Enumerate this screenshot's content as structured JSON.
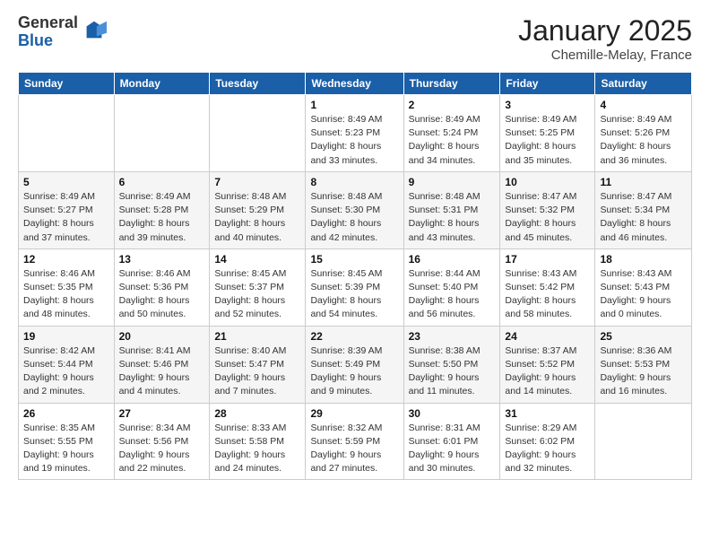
{
  "logo": {
    "general": "General",
    "blue": "Blue"
  },
  "title": "January 2025",
  "subtitle": "Chemille-Melay, France",
  "days_of_week": [
    "Sunday",
    "Monday",
    "Tuesday",
    "Wednesday",
    "Thursday",
    "Friday",
    "Saturday"
  ],
  "weeks": [
    [
      {
        "day": "",
        "info": ""
      },
      {
        "day": "",
        "info": ""
      },
      {
        "day": "",
        "info": ""
      },
      {
        "day": "1",
        "sunrise": "8:49 AM",
        "sunset": "5:23 PM",
        "daylight": "8 hours and 33 minutes."
      },
      {
        "day": "2",
        "sunrise": "8:49 AM",
        "sunset": "5:24 PM",
        "daylight": "8 hours and 34 minutes."
      },
      {
        "day": "3",
        "sunrise": "8:49 AM",
        "sunset": "5:25 PM",
        "daylight": "8 hours and 35 minutes."
      },
      {
        "day": "4",
        "sunrise": "8:49 AM",
        "sunset": "5:26 PM",
        "daylight": "8 hours and 36 minutes."
      }
    ],
    [
      {
        "day": "5",
        "sunrise": "8:49 AM",
        "sunset": "5:27 PM",
        "daylight": "8 hours and 37 minutes."
      },
      {
        "day": "6",
        "sunrise": "8:49 AM",
        "sunset": "5:28 PM",
        "daylight": "8 hours and 39 minutes."
      },
      {
        "day": "7",
        "sunrise": "8:48 AM",
        "sunset": "5:29 PM",
        "daylight": "8 hours and 40 minutes."
      },
      {
        "day": "8",
        "sunrise": "8:48 AM",
        "sunset": "5:30 PM",
        "daylight": "8 hours and 42 minutes."
      },
      {
        "day": "9",
        "sunrise": "8:48 AM",
        "sunset": "5:31 PM",
        "daylight": "8 hours and 43 minutes."
      },
      {
        "day": "10",
        "sunrise": "8:47 AM",
        "sunset": "5:32 PM",
        "daylight": "8 hours and 45 minutes."
      },
      {
        "day": "11",
        "sunrise": "8:47 AM",
        "sunset": "5:34 PM",
        "daylight": "8 hours and 46 minutes."
      }
    ],
    [
      {
        "day": "12",
        "sunrise": "8:46 AM",
        "sunset": "5:35 PM",
        "daylight": "8 hours and 48 minutes."
      },
      {
        "day": "13",
        "sunrise": "8:46 AM",
        "sunset": "5:36 PM",
        "daylight": "8 hours and 50 minutes."
      },
      {
        "day": "14",
        "sunrise": "8:45 AM",
        "sunset": "5:37 PM",
        "daylight": "8 hours and 52 minutes."
      },
      {
        "day": "15",
        "sunrise": "8:45 AM",
        "sunset": "5:39 PM",
        "daylight": "8 hours and 54 minutes."
      },
      {
        "day": "16",
        "sunrise": "8:44 AM",
        "sunset": "5:40 PM",
        "daylight": "8 hours and 56 minutes."
      },
      {
        "day": "17",
        "sunrise": "8:43 AM",
        "sunset": "5:42 PM",
        "daylight": "8 hours and 58 minutes."
      },
      {
        "day": "18",
        "sunrise": "8:43 AM",
        "sunset": "5:43 PM",
        "daylight": "9 hours and 0 minutes."
      }
    ],
    [
      {
        "day": "19",
        "sunrise": "8:42 AM",
        "sunset": "5:44 PM",
        "daylight": "9 hours and 2 minutes."
      },
      {
        "day": "20",
        "sunrise": "8:41 AM",
        "sunset": "5:46 PM",
        "daylight": "9 hours and 4 minutes."
      },
      {
        "day": "21",
        "sunrise": "8:40 AM",
        "sunset": "5:47 PM",
        "daylight": "9 hours and 7 minutes."
      },
      {
        "day": "22",
        "sunrise": "8:39 AM",
        "sunset": "5:49 PM",
        "daylight": "9 hours and 9 minutes."
      },
      {
        "day": "23",
        "sunrise": "8:38 AM",
        "sunset": "5:50 PM",
        "daylight": "9 hours and 11 minutes."
      },
      {
        "day": "24",
        "sunrise": "8:37 AM",
        "sunset": "5:52 PM",
        "daylight": "9 hours and 14 minutes."
      },
      {
        "day": "25",
        "sunrise": "8:36 AM",
        "sunset": "5:53 PM",
        "daylight": "9 hours and 16 minutes."
      }
    ],
    [
      {
        "day": "26",
        "sunrise": "8:35 AM",
        "sunset": "5:55 PM",
        "daylight": "9 hours and 19 minutes."
      },
      {
        "day": "27",
        "sunrise": "8:34 AM",
        "sunset": "5:56 PM",
        "daylight": "9 hours and 22 minutes."
      },
      {
        "day": "28",
        "sunrise": "8:33 AM",
        "sunset": "5:58 PM",
        "daylight": "9 hours and 24 minutes."
      },
      {
        "day": "29",
        "sunrise": "8:32 AM",
        "sunset": "5:59 PM",
        "daylight": "9 hours and 27 minutes."
      },
      {
        "day": "30",
        "sunrise": "8:31 AM",
        "sunset": "6:01 PM",
        "daylight": "9 hours and 30 minutes."
      },
      {
        "day": "31",
        "sunrise": "8:29 AM",
        "sunset": "6:02 PM",
        "daylight": "9 hours and 32 minutes."
      },
      {
        "day": "",
        "info": ""
      }
    ]
  ],
  "labels": {
    "sunrise": "Sunrise:",
    "sunset": "Sunset:",
    "daylight": "Daylight:"
  }
}
